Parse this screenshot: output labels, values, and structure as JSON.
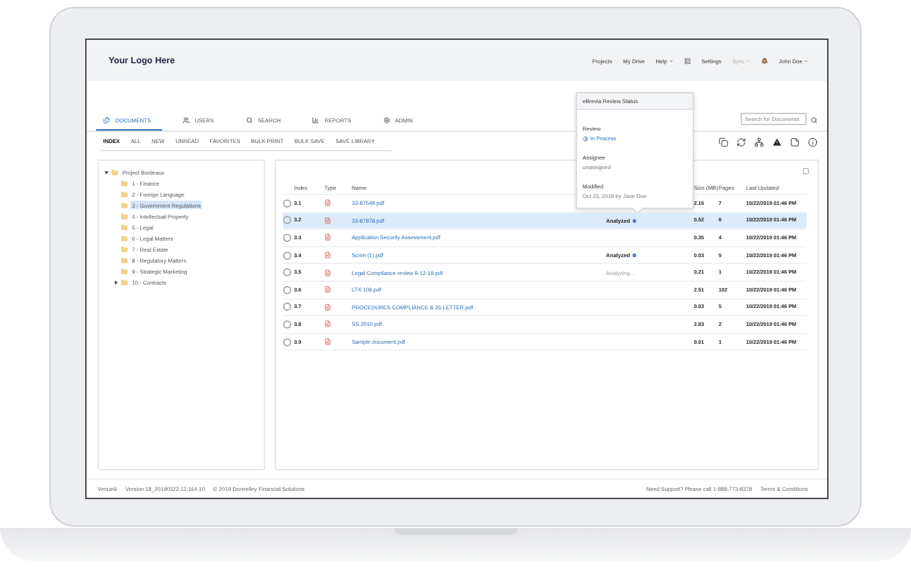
{
  "header": {
    "logo": "Your Logo Here",
    "nav": [
      {
        "kind": "link",
        "label": "Projects",
        "dropdown": false,
        "disabled": false
      },
      {
        "kind": "link",
        "label": "My Drive",
        "dropdown": false,
        "disabled": false
      },
      {
        "kind": "link",
        "label": "Help",
        "dropdown": true,
        "disabled": false
      },
      {
        "kind": "apps"
      },
      {
        "kind": "link",
        "label": "Settings",
        "dropdown": false,
        "disabled": false
      },
      {
        "kind": "link",
        "label": "Sync",
        "dropdown": true,
        "disabled": true
      },
      {
        "kind": "notifications"
      },
      {
        "kind": "link",
        "label": "John Doe",
        "dropdown": true,
        "disabled": false
      }
    ]
  },
  "tabs": [
    {
      "label": "DOCUMENTS",
      "selected": true
    },
    {
      "label": "USERS",
      "selected": false
    },
    {
      "label": "SEARCH",
      "selected": false
    },
    {
      "label": "REPORTS",
      "selected": false
    },
    {
      "label": "ADMIN",
      "selected": false
    }
  ],
  "search": {
    "placeholder": "Search for Documents"
  },
  "subtabs": [
    {
      "label": "INDEX",
      "selected": true
    },
    {
      "label": "ALL",
      "selected": false
    },
    {
      "label": "NEW",
      "selected": false
    },
    {
      "label": "UNREAD",
      "selected": false
    },
    {
      "label": "FAVORITES",
      "selected": false
    },
    {
      "label": "BULK PRINT",
      "selected": false
    },
    {
      "label": "BULK SAVE",
      "selected": false
    },
    {
      "label": "SAVE LIBRARY",
      "selected": false
    }
  ],
  "tree": [
    {
      "label": "Project Bordeaux",
      "expanded": true,
      "selected": false,
      "children": [
        {
          "label": "1 - Finance",
          "selected": false
        },
        {
          "label": "2 - Foreign Language",
          "selected": false
        },
        {
          "label": "3 - Government Regulations",
          "selected": true
        },
        {
          "label": "4 - Intellectual Property",
          "selected": false
        },
        {
          "label": "5 - Legal",
          "selected": false
        },
        {
          "label": "6 - Legal Matters",
          "selected": false
        },
        {
          "label": "7 - Real Estate",
          "selected": false
        },
        {
          "label": "8 - Regulatory Matters",
          "selected": false
        },
        {
          "label": "9 - Strategic Marketing",
          "selected": false
        },
        {
          "label": "10 - Contracts",
          "expanded": false,
          "selected": false
        }
      ]
    }
  ],
  "table": {
    "columns": [
      "Index",
      "Type",
      "Name",
      "Size (MB)",
      "Pages",
      "Last Updated"
    ],
    "rows": [
      {
        "index": "3.1",
        "name": "33-87549.pdf",
        "size": "2.15",
        "pages": "7",
        "updated": "10/22/2019 01:46 PM",
        "selected": false
      },
      {
        "index": "3.2",
        "name": "33-87878.pdf",
        "status": {
          "kind": "done",
          "text": "Analyzed"
        },
        "size": "0.52",
        "pages": "6",
        "updated": "10/22/2019 01:46 PM",
        "selected": true
      },
      {
        "index": "3.3",
        "name": "Application Security Assessment.pdf",
        "size": "0.35",
        "pages": "4",
        "updated": "10/22/2019 01:46 PM",
        "selected": false
      },
      {
        "index": "3.4",
        "name": "Scrim (1).pdf",
        "status": {
          "kind": "done",
          "text": "Analyzed"
        },
        "size": "0.03",
        "pages": "5",
        "updated": "10/22/2019 01:46 PM",
        "selected": false
      },
      {
        "index": "3.5",
        "name": "Legal Compliance review 9-12-18.pdf",
        "status": {
          "kind": "pending",
          "text": "Analyzing..."
        },
        "size": "0.21",
        "pages": "1",
        "updated": "10/22/2019 01:46 PM",
        "selected": false
      },
      {
        "index": "3.6",
        "name": "LTX 106.pdf",
        "size": "2.51",
        "pages": "102",
        "updated": "10/22/2019 01:46 PM",
        "selected": false
      },
      {
        "index": "3.7",
        "name": "PROCEDURES COMPLIANCE & 26 LETTER.pdf",
        "size": "0.03",
        "pages": "5",
        "updated": "10/22/2019 01:46 PM",
        "selected": false
      },
      {
        "index": "3.8",
        "name": "SS 2010.pdf",
        "size": "2.83",
        "pages": "2",
        "updated": "10/22/2019 01:46 PM",
        "selected": false
      },
      {
        "index": "3.9",
        "name": "Sample document.pdf",
        "size": "0.01",
        "pages": "1",
        "updated": "10/22/2019 01:46 PM",
        "selected": false
      }
    ]
  },
  "popup": {
    "title": "eBrevia Review Status",
    "fields": [
      {
        "label": "Review",
        "value": "In Process",
        "kind": "status"
      },
      {
        "label": "Assignee",
        "value": "unassigned",
        "kind": "text"
      },
      {
        "label": "Modified",
        "value": "Oct 23, 2019 by Jane Doe",
        "kind": "text"
      }
    ]
  },
  "footer": {
    "brand": "Venue®",
    "version": "Version 18_20190322.12.164.10",
    "copyright": "© 2019 Donnelley Financial Solutions",
    "support": "Need Support? Please call 1-888-773-8378",
    "terms": "Terms & Conditions"
  }
}
